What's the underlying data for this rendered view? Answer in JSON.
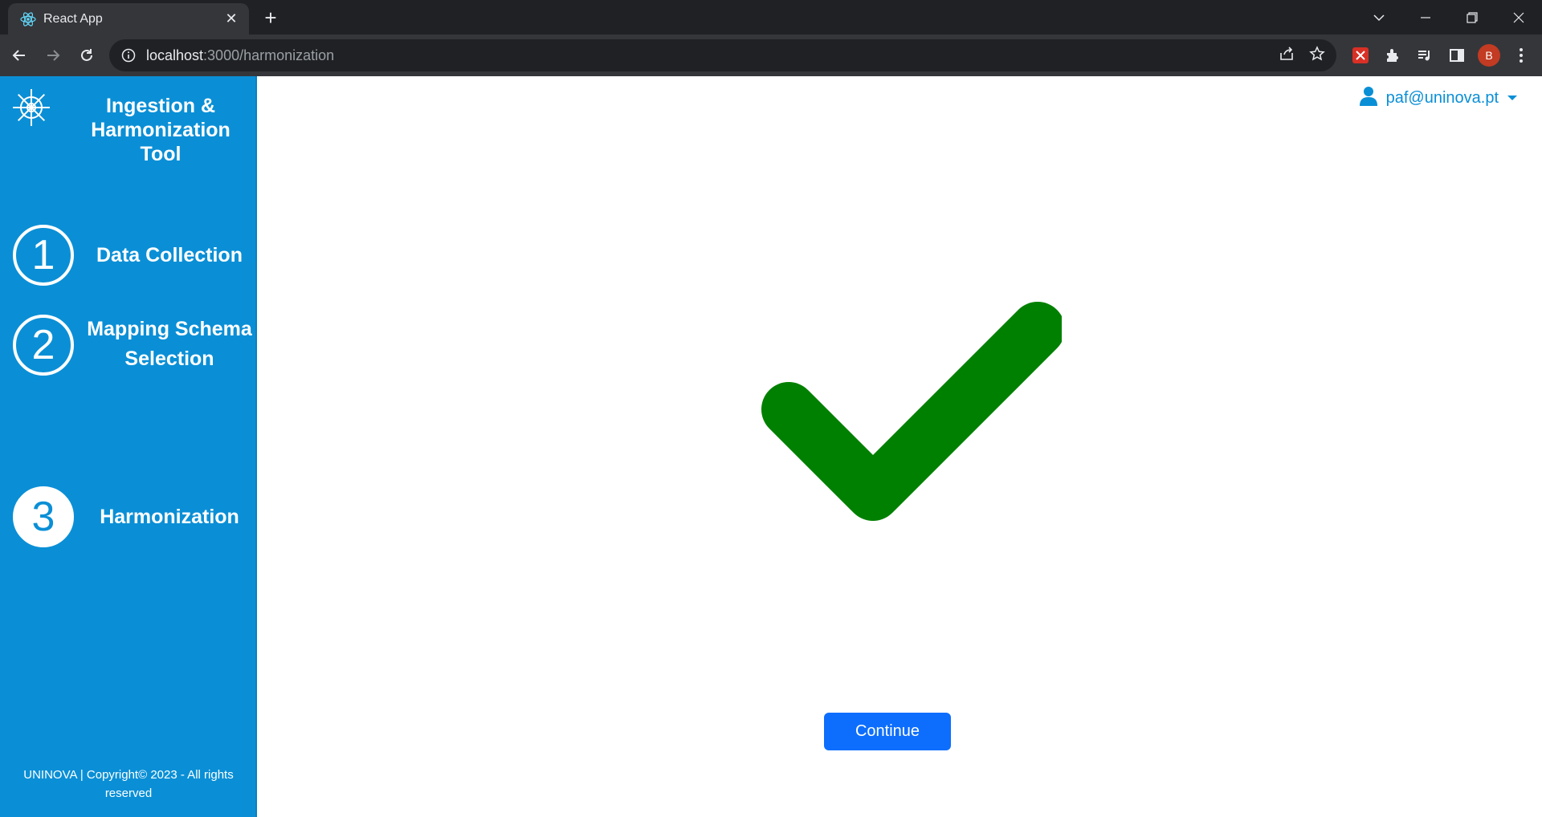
{
  "browser": {
    "tab_title": "React App",
    "url_host": "localhost",
    "url_path": ":3000/harmonization",
    "profile_initial": "B"
  },
  "sidebar": {
    "title": "Ingestion & Harmonization Tool",
    "steps": [
      {
        "number": "1",
        "label": "Data Collection",
        "active": false
      },
      {
        "number": "2",
        "label": "Mapping Schema Selection",
        "active": false
      },
      {
        "number": "3",
        "label": "Harmonization",
        "active": true
      }
    ],
    "footer": "UNINOVA | Copyright© 2023 - All rights reserved"
  },
  "header": {
    "user_email": "paf@uninova.pt"
  },
  "main": {
    "status_icon": "checkmark-icon",
    "status_color": "#008000",
    "continue_label": "Continue"
  },
  "colors": {
    "sidebar": "#0a8fd6",
    "primary_button": "#0d6efd"
  }
}
